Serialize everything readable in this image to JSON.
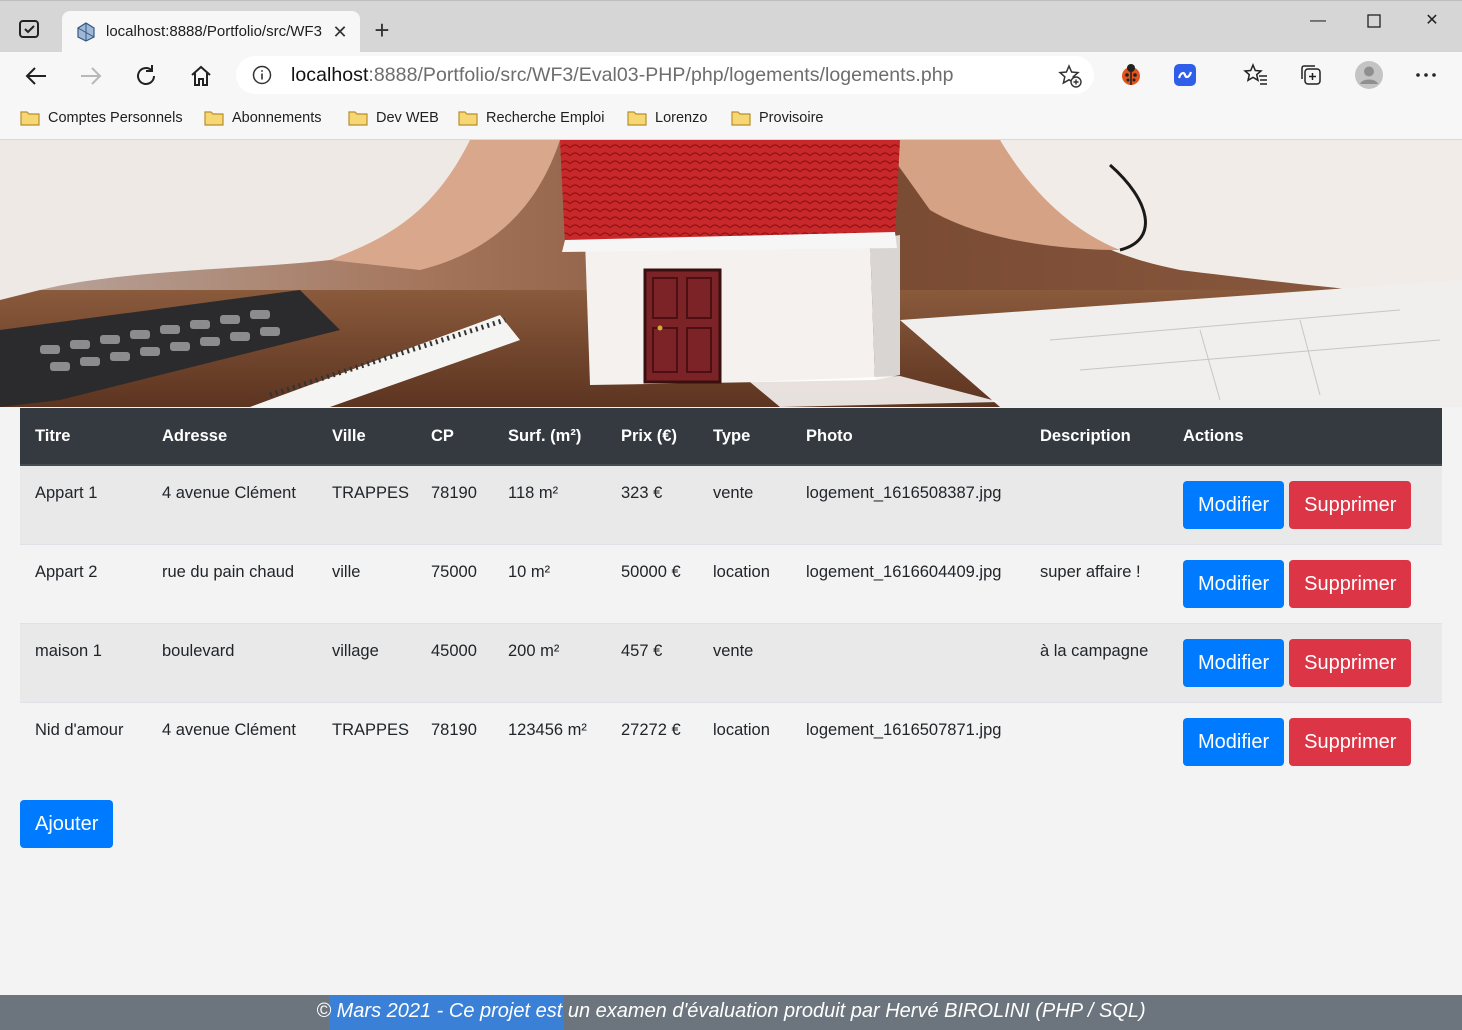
{
  "browser": {
    "tab_title": "localhost:8888/Portfolio/src/WF3",
    "url_host": "localhost",
    "url_rest": ":8888/Portfolio/src/WF3/Eval03-PHP/php/logements/logements.php",
    "bookmarks": [
      "Comptes Personnels",
      "Abonnements",
      "Dev WEB",
      "Recherche Emploi",
      "Lorenzo",
      "Provisoire"
    ]
  },
  "table": {
    "headers": [
      "Titre",
      "Adresse",
      "Ville",
      "CP",
      "Surf. (m²)",
      "Prix (€)",
      "Type",
      "Photo",
      "Description",
      "Actions"
    ],
    "rows": [
      {
        "titre": "Appart 1",
        "adresse": "4 avenue Clément",
        "ville": "TRAPPES",
        "cp": "78190",
        "surf": "118 m²",
        "prix": "323 €",
        "type": "vente",
        "photo": "logement_1616508387.jpg",
        "description": ""
      },
      {
        "titre": "Appart 2",
        "adresse": "rue du pain chaud",
        "ville": "ville",
        "cp": "75000",
        "surf": "10 m²",
        "prix": "50000 €",
        "type": "location",
        "photo": "logement_1616604409.jpg",
        "description": "super affaire !"
      },
      {
        "titre": "maison 1",
        "adresse": "boulevard",
        "ville": "village",
        "cp": "45000",
        "surf": "200 m²",
        "prix": "457 €",
        "type": "vente",
        "photo": "",
        "description": "à la campagne"
      },
      {
        "titre": "Nid d'amour",
        "adresse": "4 avenue Clément",
        "ville": "TRAPPES",
        "cp": "78190",
        "surf": "123456 m²",
        "prix": "27272 €",
        "type": "location",
        "photo": "logement_1616507871.jpg",
        "description": ""
      }
    ],
    "modify_label": "Modifier",
    "delete_label": "Supprimer"
  },
  "add_label": "Ajouter",
  "footer_text": "© Mars 2021 - Ce projet est un examen d'évaluation produit par Hervé BIROLINI (PHP / SQL)",
  "colors": {
    "primary": "#007bff",
    "danger": "#dc3545",
    "header": "#343a40",
    "footer": "#6c757d"
  }
}
